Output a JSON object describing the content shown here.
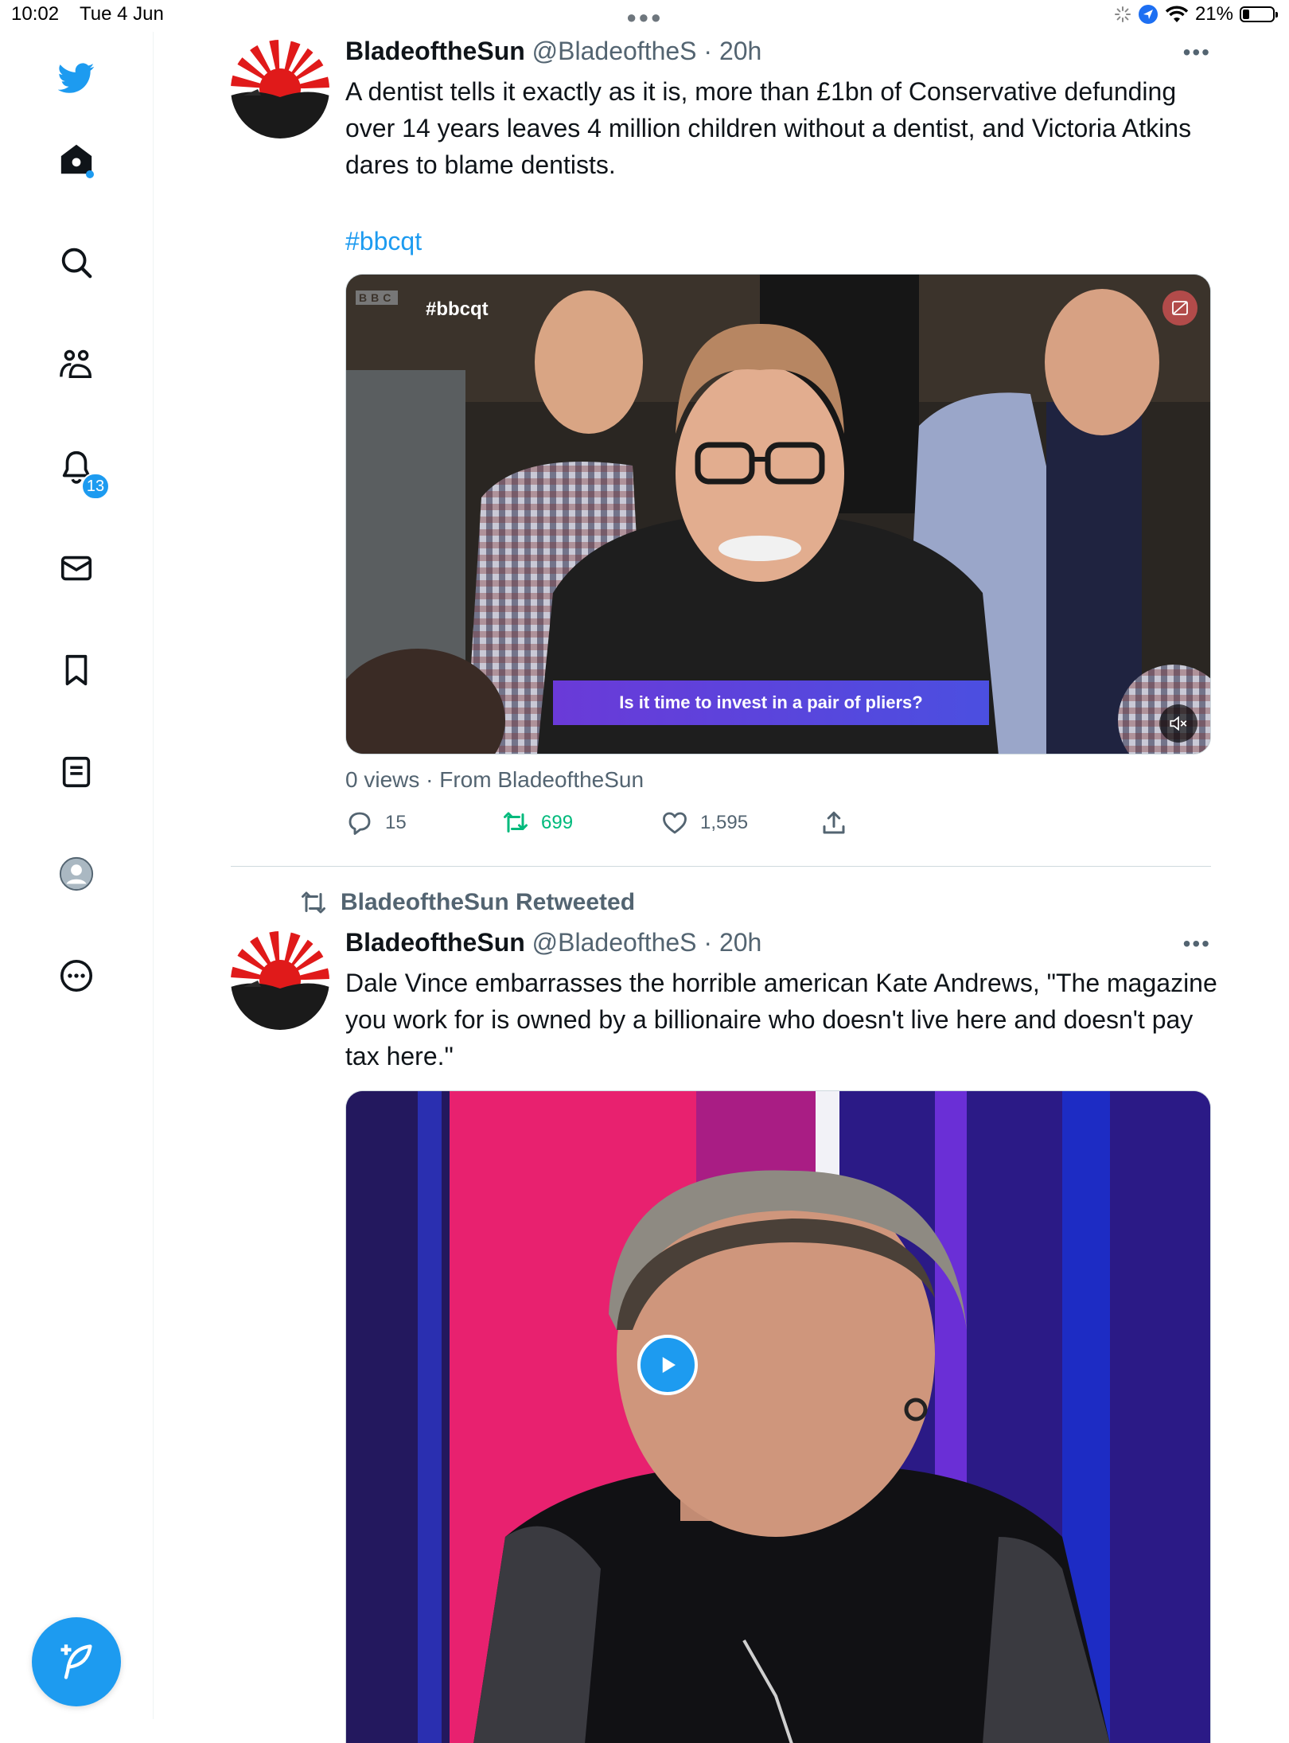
{
  "status_bar": {
    "time": "10:02",
    "date": "Tue 4 Jun",
    "battery": "21%",
    "battery_level": 0.21
  },
  "sidebar": {
    "items": [
      {
        "name": "twitter-logo",
        "icon": "bird-icon"
      },
      {
        "name": "home",
        "icon": "home-icon"
      },
      {
        "name": "explore",
        "icon": "search-icon"
      },
      {
        "name": "communities",
        "icon": "communities-icon"
      },
      {
        "name": "notifications",
        "icon": "bell-icon",
        "badge": "13"
      },
      {
        "name": "messages",
        "icon": "envelope-icon"
      },
      {
        "name": "bookmarks",
        "icon": "bookmark-icon"
      },
      {
        "name": "lists",
        "icon": "lists-icon"
      },
      {
        "name": "profile",
        "icon": "avatar-icon"
      },
      {
        "name": "more",
        "icon": "more-circle-icon"
      }
    ],
    "compose_icon": "compose-icon"
  },
  "tweets": [
    {
      "name": "BladeoftheSun",
      "handle": "@BladeoftheS",
      "time": "· 20h",
      "text": "A dentist tells it exactly as it is, more than £1bn of Conservative defunding over 14 years leaves 4 million children without a dentist, and Victoria Atkins dares to blame dentists.",
      "hashtag": "#bbcqt",
      "video": {
        "corner_logo": "BBC",
        "tag": "#bbcqt",
        "caption": "Is it time to invest in a pair of pliers?"
      },
      "meta": "0 views · From BladeoftheSun",
      "replies": "15",
      "retweets": "699",
      "likes": "1,595"
    },
    {
      "retweeted_by": "BladeoftheSun Retweeted",
      "name": "BladeoftheSun",
      "handle": "@BladeoftheS",
      "time": "· 20h",
      "text": "Dale Vince embarrasses the horrible american Kate Andrews, \"The magazine you work for is owned by a billionaire who doesn't live here and doesn't pay tax here.\""
    }
  ],
  "colors": {
    "accent": "#1d9bf0",
    "retweet_green": "#00ba7c",
    "secondary_text": "#536471"
  }
}
